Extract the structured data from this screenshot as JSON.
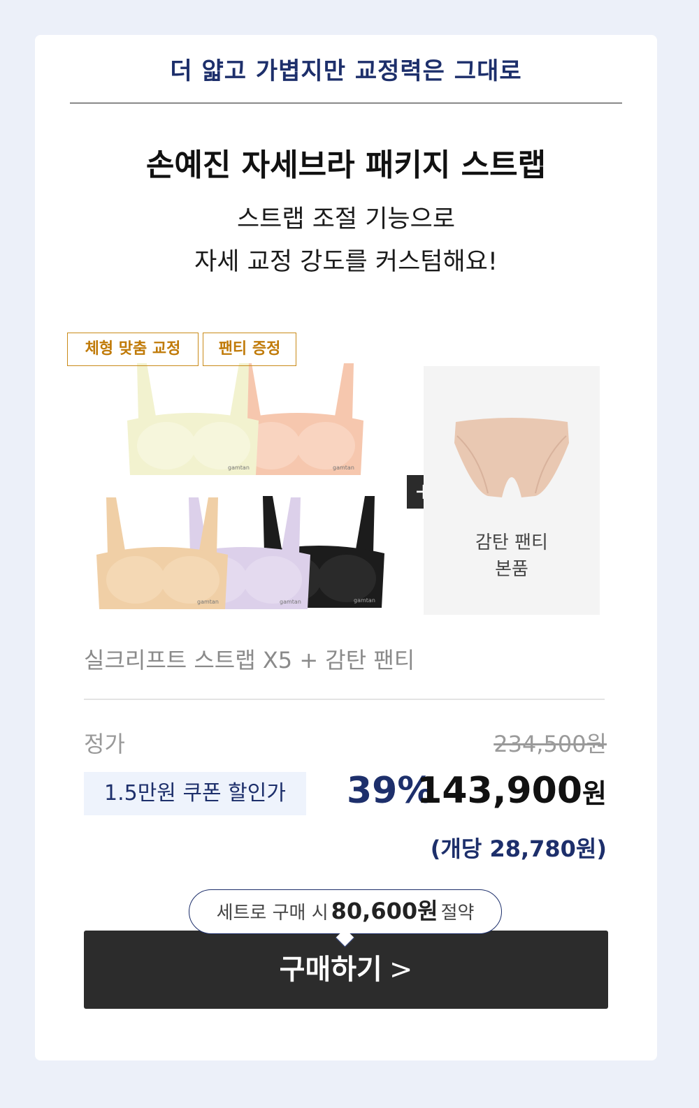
{
  "header": {
    "tagline": "더 얇고 가볍지만 교정력은 그대로"
  },
  "product": {
    "title": "손예진 자세브라 패키지 스트랩",
    "subtitle_line1": "스트랩 조절 기능으로",
    "subtitle_line2": "자세 교정 강도를 커스텀해요!",
    "tags": [
      "체형 맞춤 교정",
      "팬티 증정"
    ],
    "brand_on_garment": "gamtan",
    "bonus_name_line1": "감탄 팬티",
    "bonus_name_line2": "본품",
    "plus_symbol": "+",
    "name": "실크리프트 스트랩 X5 + 감탄 팬티",
    "colors": {
      "yellow": "#f2f2cf",
      "peach": "#f6c7ae",
      "beige": "#f0cfa6",
      "lavender": "#dcd0ea",
      "black": "#1c1c1c",
      "panty": "#e9c8b2"
    }
  },
  "pricing": {
    "regular_label": "정가",
    "regular_price": "234,500원",
    "coupon_label": "1.5만원 쿠폰 할인가",
    "discount_rate": "39%",
    "sale_price": "143,900",
    "currency": "원",
    "unit_price": "(개당 28,780원)"
  },
  "cta": {
    "savings_prefix": "세트로 구매 시",
    "savings_amount": "80,600원",
    "savings_suffix": "절약",
    "buy_label": "구매하기",
    "buy_icon": "chevron-right-icon"
  },
  "theme": {
    "accent": "#1d2f6b",
    "tag": "#c07a08",
    "page_bg": "#ecf0f9"
  }
}
